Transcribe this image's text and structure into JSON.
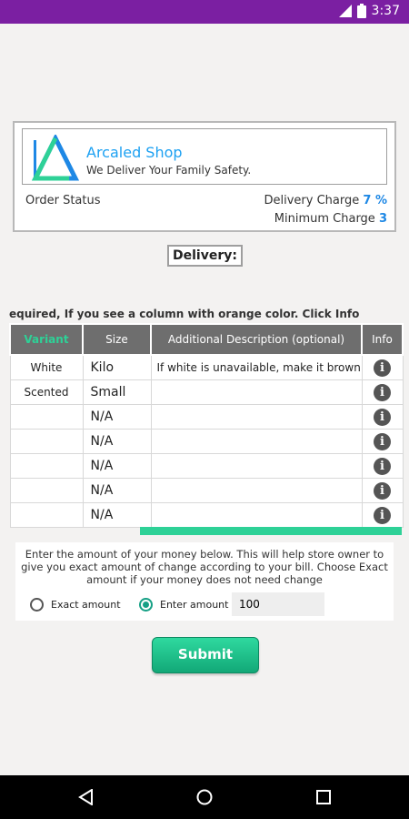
{
  "status_bar": {
    "time": "3:37"
  },
  "shop": {
    "name": "Arcaled Shop",
    "tagline": "We Deliver Your Family Safety.",
    "order_status_label": "Order Status",
    "delivery_charge_label": "Delivery Charge",
    "delivery_charge_value": "7 %",
    "minimum_charge_label": "Minimum Charge",
    "minimum_charge_value": "3",
    "logo_colors": [
      "#1e88e5",
      "#2ed197"
    ]
  },
  "delivery_label": "Delivery:",
  "instruction": "equired, If you see a column with orange color. Click Info",
  "table": {
    "headers": [
      "Variant",
      "Size",
      "Additional Description (optional)",
      "Info"
    ],
    "rows": [
      {
        "variant": "White",
        "size": "Kilo",
        "description": "If white is unavailable, make it brown"
      },
      {
        "variant": "Scented",
        "size": "Small",
        "description": ""
      },
      {
        "variant": "",
        "size": "N/A",
        "description": ""
      },
      {
        "variant": "",
        "size": "N/A",
        "description": ""
      },
      {
        "variant": "",
        "size": "N/A",
        "description": ""
      },
      {
        "variant": "",
        "size": "N/A",
        "description": ""
      },
      {
        "variant": "",
        "size": "N/A",
        "description": ""
      }
    ],
    "info_icon": "info-circle"
  },
  "amount": {
    "description": "Enter the amount of your money below. This will help store owner to give you exact amount of change according to your bill. Choose Exact amount if your money does not need change",
    "exact_label": "Exact amount",
    "enter_label": "Enter amount",
    "selected": "enter",
    "value": "100"
  },
  "submit_label": "Submit",
  "colors": {
    "accent": "#2ed197",
    "status_bar": "#7b1fa2",
    "link": "#1e88e5"
  }
}
